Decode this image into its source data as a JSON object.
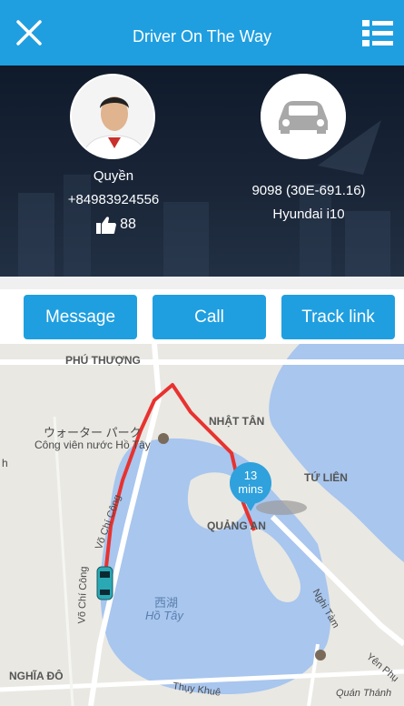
{
  "header": {
    "title": "Driver On The Way",
    "close_icon": "close-icon",
    "menu_icon": "list-menu-icon",
    "color": "#1f9fe0"
  },
  "driver": {
    "name": "Quyền",
    "phone": "+84983924556",
    "likes": "88",
    "like_icon": "thumbs-up-icon"
  },
  "vehicle": {
    "plate": "9098 (30E-691.16)",
    "model": "Hyundai  i10",
    "car_icon": "car-icon"
  },
  "actions": {
    "message_label": "Message",
    "call_label": "Call",
    "track_label": "Track link"
  },
  "map": {
    "eta_value": "13",
    "eta_unit": "mins",
    "labels": {
      "phu_thuong": "PHÚ THƯỢNG",
      "nhat_tan": "NHẬT TÂN",
      "water_park_jp": "ウォーター パーク",
      "water_park_vi": "Công viên nước Hồ Tây",
      "tu_lien": "TỨ LIÊN",
      "quang_an": "QUẢNG AN",
      "vo_chi_cong_1": "Võ Chí Công",
      "vo_chi_cong_2": "Võ Chí Công",
      "lake_jp": "西湖",
      "lake_vi": "Hồ Tây",
      "nghi_tam": "Nghi Tàm",
      "nghia_do": "NGHĨA ĐÔ",
      "thuy_khue": "Thụy Khuê",
      "yen_phu": "Yên Phụ",
      "quan_thanh": "Quán Thánh",
      "h": "h"
    }
  }
}
